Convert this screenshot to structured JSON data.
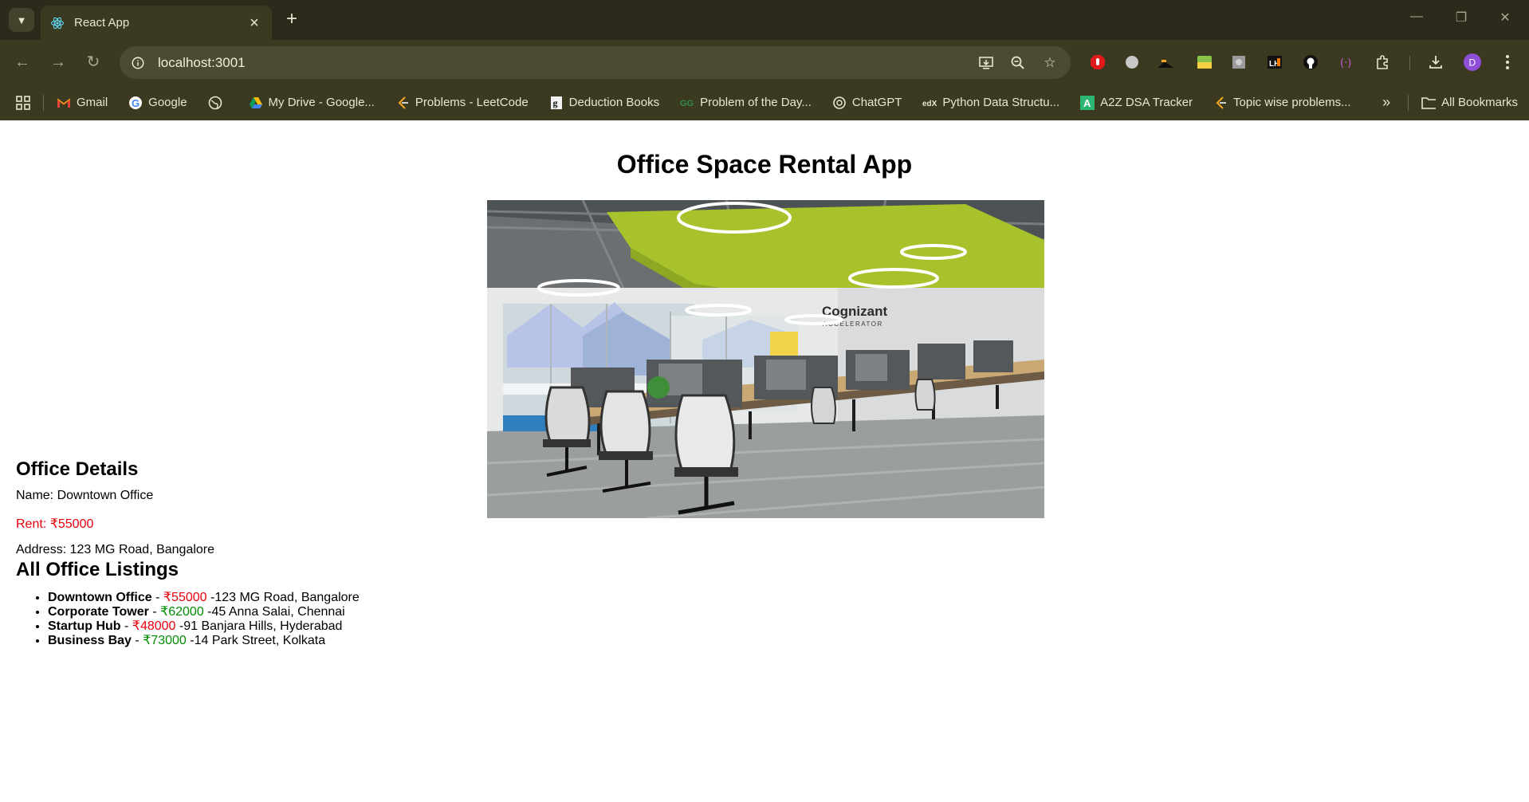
{
  "browser": {
    "tab_title": "React App",
    "url": "localhost:3001",
    "bookmarks": [
      {
        "label": "Gmail",
        "icon": "gmail-icon"
      },
      {
        "label": "Google",
        "icon": "google-icon"
      },
      {
        "label": "",
        "icon": "globe-icon"
      },
      {
        "label": "My Drive - Google...",
        "icon": "drive-icon"
      },
      {
        "label": "Problems - LeetCode",
        "icon": "leetcode-icon"
      },
      {
        "label": "Deduction Books",
        "icon": "books-icon"
      },
      {
        "label": "Problem of the Day...",
        "icon": "gfg-icon"
      },
      {
        "label": "ChatGPT",
        "icon": "chatgpt-icon"
      },
      {
        "label": "Python Data Structu...",
        "icon": "edx-icon"
      },
      {
        "label": "A2Z DSA Tracker",
        "icon": "a2z-icon"
      },
      {
        "label": "Topic wise problems...",
        "icon": "leetcode-icon"
      }
    ],
    "all_bookmarks": "All Bookmarks",
    "profile_initial": "D"
  },
  "page": {
    "title": "Office Space Rental App",
    "image_sign": {
      "brand": "Cognizant",
      "sub": "ACCELERATOR"
    },
    "details": {
      "heading": "Office Details",
      "name": "Name: Downtown Office",
      "rent": "Rent: ₹55000",
      "address": "Address: 123 MG Road, Bangalore"
    },
    "listings_heading": "All Office Listings",
    "listings": [
      {
        "name": "Downtown Office",
        "sep": " - ",
        "rent": "₹55000",
        "rent_color": "red",
        "address": " -123 MG Road, Bangalore"
      },
      {
        "name": "Corporate Tower",
        "sep": " - ",
        "rent": "₹62000",
        "rent_color": "green",
        "address": " -45 Anna Salai, Chennai"
      },
      {
        "name": "Startup Hub",
        "sep": " - ",
        "rent": "₹48000",
        "rent_color": "red",
        "address": " -91 Banjara Hills, Hyderabad"
      },
      {
        "name": "Business Bay",
        "sep": " - ",
        "rent": "₹73000",
        "rent_color": "green",
        "address": " -14 Park Street, Kolkata"
      }
    ]
  }
}
